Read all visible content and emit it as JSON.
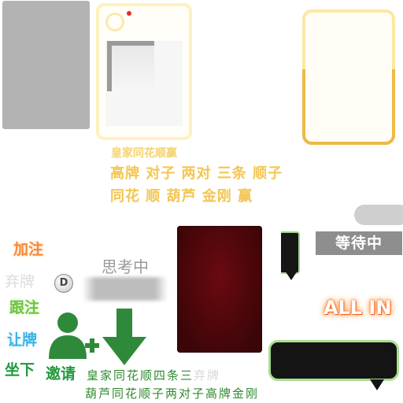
{
  "hand_ranks": {
    "royal_flush": "皇家同花顺赢",
    "line1": "高牌 对子 两对 三条 顺子",
    "line2": "同花 顺 葫芦 金刚 赢"
  },
  "status": {
    "waiting": "等待中",
    "thinking": "思考中"
  },
  "actions": {
    "raise": "加注",
    "fold": "弃牌",
    "call": "跟注",
    "check": "让牌",
    "sit_down": "坐下",
    "invite": "邀请",
    "all_in": "ALL IN"
  },
  "dealer_chip": "D",
  "green_labels": {
    "line1_main": "皇家同花顺四条三",
    "line1_faint": "弃牌",
    "line2": "葫芦同花顺子两对子高牌金刚"
  },
  "icons": [
    "avatar-ring-icon",
    "add-user-icon",
    "down-arrow-icon",
    "dealer-chip-icon"
  ],
  "colors": {
    "gold": "#f2c75a",
    "raise": "#f58a3c",
    "call": "#6ec43f",
    "check": "#3bb4e3",
    "green": "#1f9a3e",
    "card_back": "#4a0509",
    "bubble_border": "#a9dd92"
  }
}
